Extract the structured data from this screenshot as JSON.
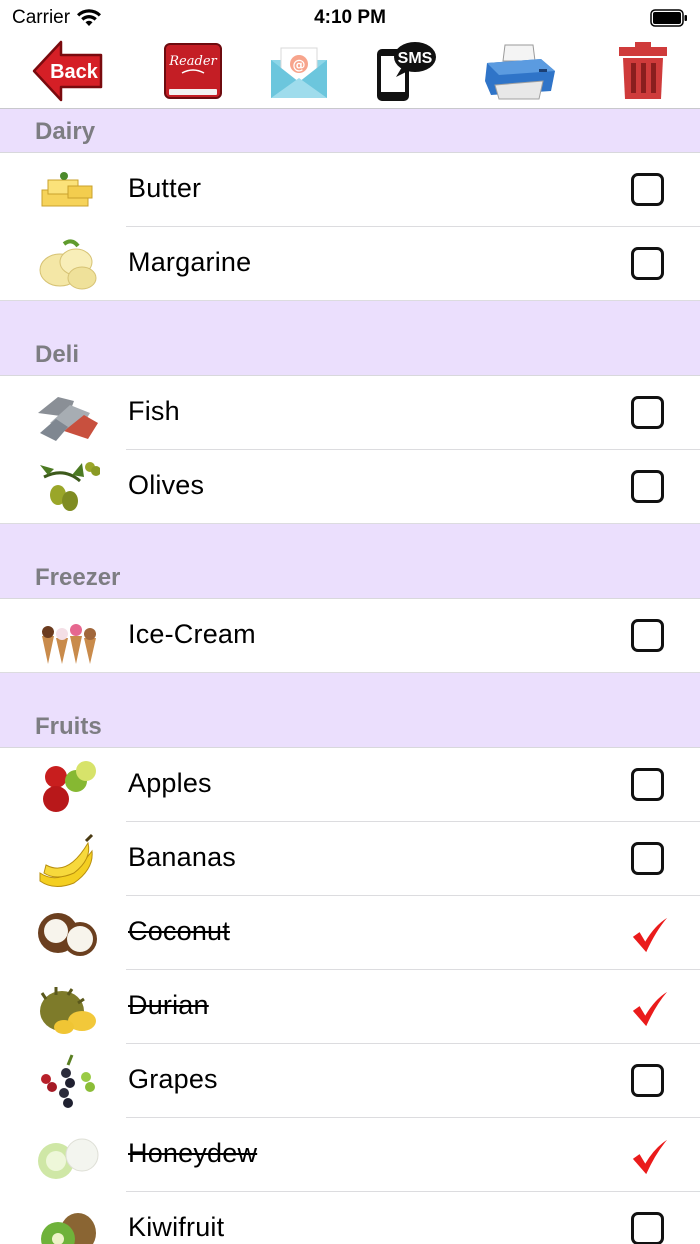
{
  "status_bar": {
    "carrier": "Carrier",
    "time": "4:10 PM"
  },
  "toolbar": {
    "back_label": "Back",
    "reader_label": "Reader",
    "email_symbol": "@",
    "sms_label": "SMS"
  },
  "colors": {
    "section_bg": "#ebdffd",
    "check_red": "#ea1b1b",
    "back_red": "#d51f26"
  },
  "sections": [
    {
      "title": "Dairy",
      "items": [
        {
          "name": "Butter",
          "checked": false,
          "icon": "butter-icon"
        },
        {
          "name": "Margarine",
          "checked": false,
          "icon": "margarine-icon"
        }
      ]
    },
    {
      "title": "Deli",
      "items": [
        {
          "name": "Fish",
          "checked": false,
          "icon": "fish-icon"
        },
        {
          "name": "Olives",
          "checked": false,
          "icon": "olives-icon"
        }
      ]
    },
    {
      "title": "Freezer",
      "items": [
        {
          "name": "Ice-Cream",
          "checked": false,
          "icon": "ice-cream-icon"
        }
      ]
    },
    {
      "title": "Fruits",
      "items": [
        {
          "name": "Apples",
          "checked": false,
          "icon": "apples-icon"
        },
        {
          "name": "Bananas",
          "checked": false,
          "icon": "bananas-icon"
        },
        {
          "name": "Coconut",
          "checked": true,
          "icon": "coconut-icon"
        },
        {
          "name": "Durian",
          "checked": true,
          "icon": "durian-icon"
        },
        {
          "name": "Grapes",
          "checked": false,
          "icon": "grapes-icon"
        },
        {
          "name": "Honeydew",
          "checked": true,
          "icon": "honeydew-icon"
        },
        {
          "name": "Kiwifruit",
          "checked": false,
          "icon": "kiwifruit-icon"
        }
      ]
    }
  ]
}
